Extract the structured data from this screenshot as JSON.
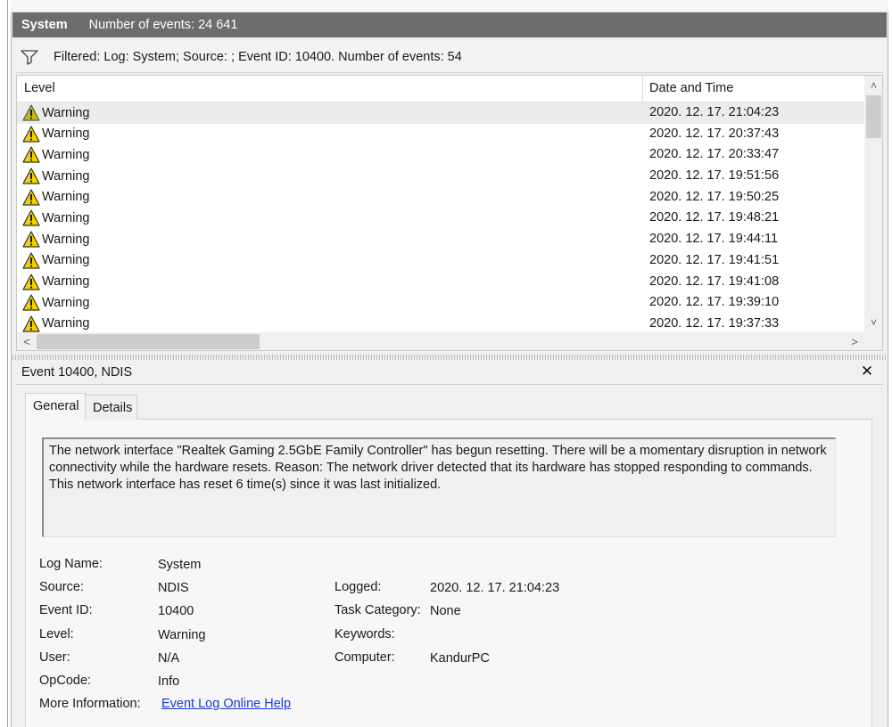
{
  "header": {
    "title": "System",
    "count_label": "Number of events: 24 641"
  },
  "filter": {
    "text": "Filtered: Log: System; Source: ; Event ID: 10400. Number of events: 54"
  },
  "grid": {
    "columns": {
      "level": "Level",
      "date": "Date and Time"
    },
    "rows": [
      {
        "level": "Warning",
        "date": "2020. 12. 17. 21:04:23"
      },
      {
        "level": "Warning",
        "date": "2020. 12. 17. 20:37:43"
      },
      {
        "level": "Warning",
        "date": "2020. 12. 17. 20:33:47"
      },
      {
        "level": "Warning",
        "date": "2020. 12. 17. 19:51:56"
      },
      {
        "level": "Warning",
        "date": "2020. 12. 17. 19:50:25"
      },
      {
        "level": "Warning",
        "date": "2020. 12. 17. 19:48:21"
      },
      {
        "level": "Warning",
        "date": "2020. 12. 17. 19:44:11"
      },
      {
        "level": "Warning",
        "date": "2020. 12. 17. 19:41:51"
      },
      {
        "level": "Warning",
        "date": "2020. 12. 17. 19:41:08"
      },
      {
        "level": "Warning",
        "date": "2020. 12. 17. 19:39:10"
      },
      {
        "level": "Warning",
        "date": "2020. 12. 17. 19:37:33"
      }
    ],
    "scroll": {
      "up": "˄",
      "down": "˅",
      "left": "<",
      "right": ">"
    }
  },
  "detail": {
    "title": "Event 10400, NDIS",
    "close": "✕",
    "tabs": {
      "general": "General",
      "details": "Details"
    },
    "description": "The network interface \"Realtek Gaming 2.5GbE Family Controller\" has begun resetting.  There will be a momentary disruption in network connectivity while the hardware resets. Reason: The network driver detected that its hardware has stopped responding to commands. This network interface has reset 6 time(s) since it was last initialized.",
    "labels": {
      "log_name": "Log Name:",
      "source": "Source:",
      "event_id": "Event ID:",
      "level": "Level:",
      "user": "User:",
      "opcode": "OpCode:",
      "more_info": "More Information:",
      "logged": "Logged:",
      "task_category": "Task Category:",
      "keywords": "Keywords:",
      "computer": "Computer:"
    },
    "values": {
      "log_name": "System",
      "source": "NDIS",
      "event_id": "10400",
      "level": "Warning",
      "user": "N/A",
      "opcode": "Info",
      "more_info_link": "Event Log Online Help",
      "logged": "2020. 12. 17. 21:04:23",
      "task_category": "None",
      "keywords": "",
      "computer": "KandurPC"
    }
  },
  "icons": {
    "filter": "filter-funnel-icon",
    "warning": "warning-triangle-icon",
    "close": "close-icon"
  },
  "colors": {
    "header_bg": "#6d6d6d",
    "warning_yellow": "#f5d000",
    "link": "#1a3ad6",
    "selection": "#ececec"
  }
}
